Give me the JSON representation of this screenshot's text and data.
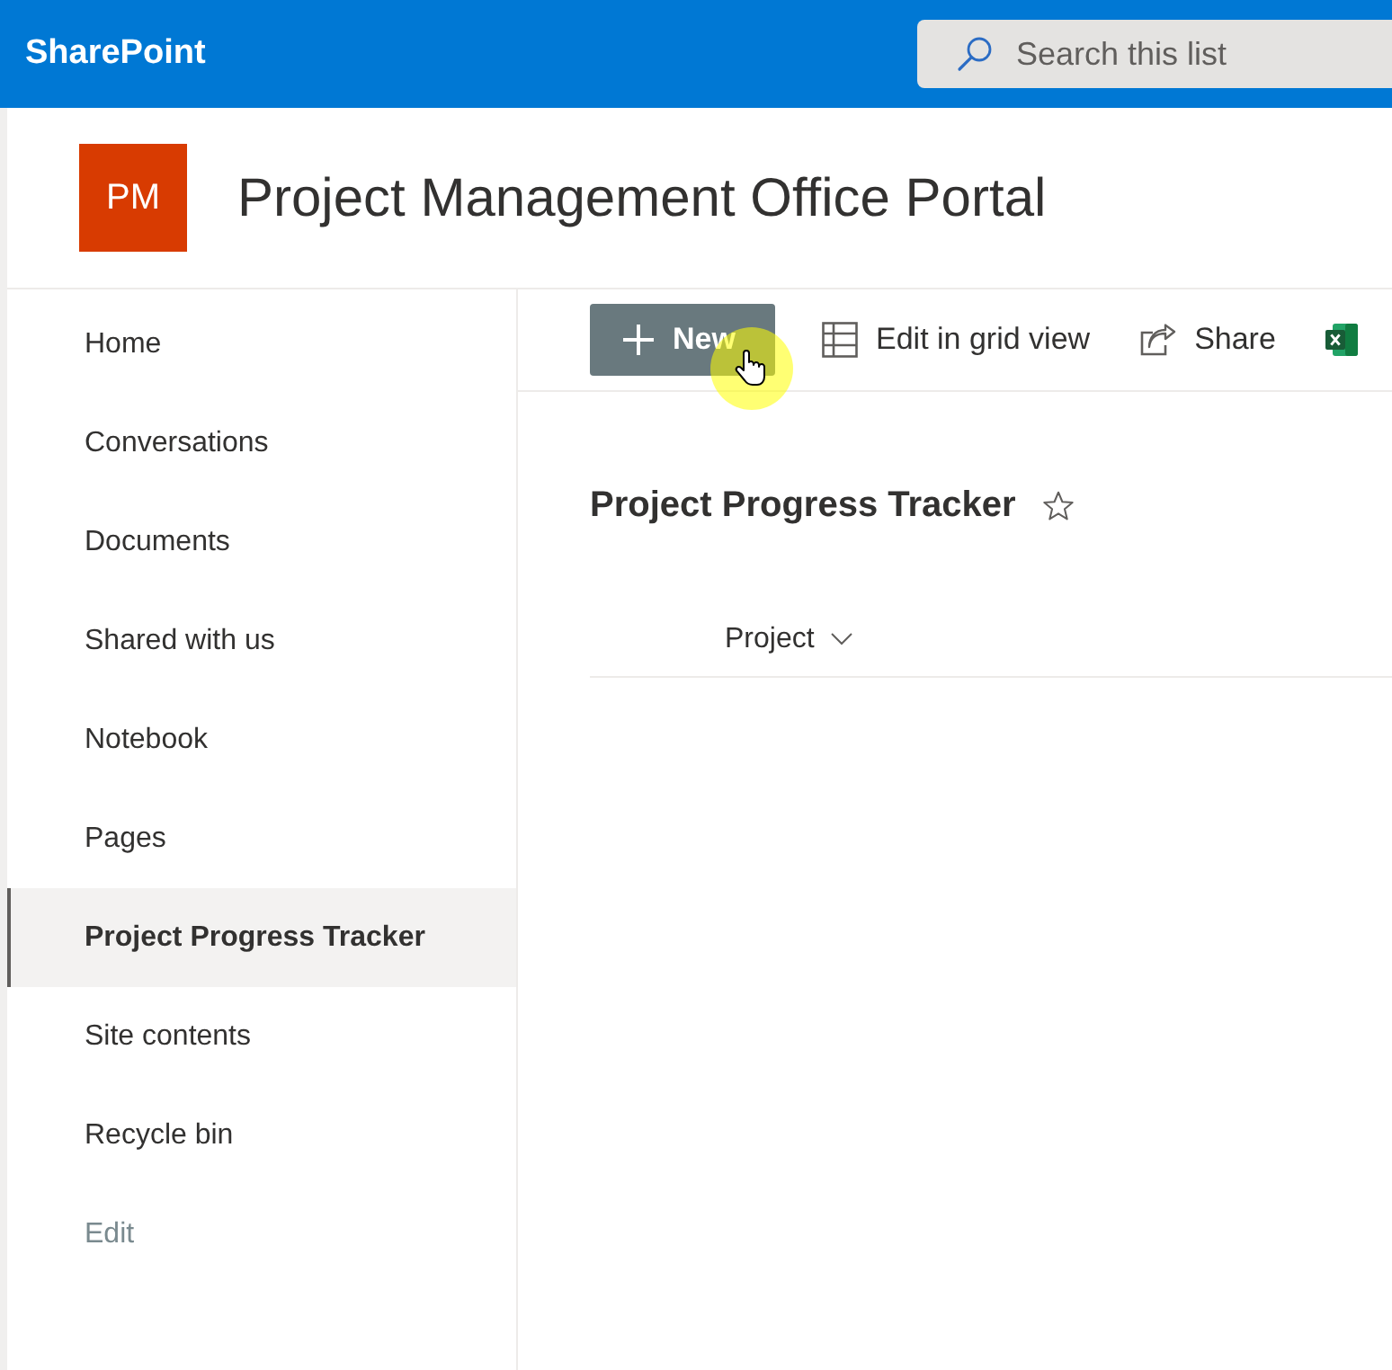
{
  "top_bar": {
    "brand": "SharePoint",
    "search": {
      "placeholder": "Search this list"
    }
  },
  "site_header": {
    "logo": "PM",
    "title": "Project Management Office Portal"
  },
  "nav": {
    "items": [
      {
        "label": "Home",
        "selected": false
      },
      {
        "label": "Conversations",
        "selected": false
      },
      {
        "label": "Documents",
        "selected": false
      },
      {
        "label": "Shared with us",
        "selected": false
      },
      {
        "label": "Notebook",
        "selected": false
      },
      {
        "label": "Pages",
        "selected": false
      },
      {
        "label": "Project Progress Tracker",
        "selected": true
      },
      {
        "label": "Site contents",
        "selected": false
      },
      {
        "label": "Recycle bin",
        "selected": false
      }
    ],
    "edit": "Edit"
  },
  "command_bar": {
    "items": [
      {
        "kind": "new",
        "label": "New"
      },
      {
        "kind": "grid",
        "label": "Edit in grid view"
      },
      {
        "kind": "share",
        "label": "Share"
      },
      {
        "kind": "excel"
      }
    ]
  },
  "list": {
    "title": "Project Progress Tracker",
    "favorite": false,
    "columns": [
      {
        "label": "Project"
      }
    ]
  }
}
